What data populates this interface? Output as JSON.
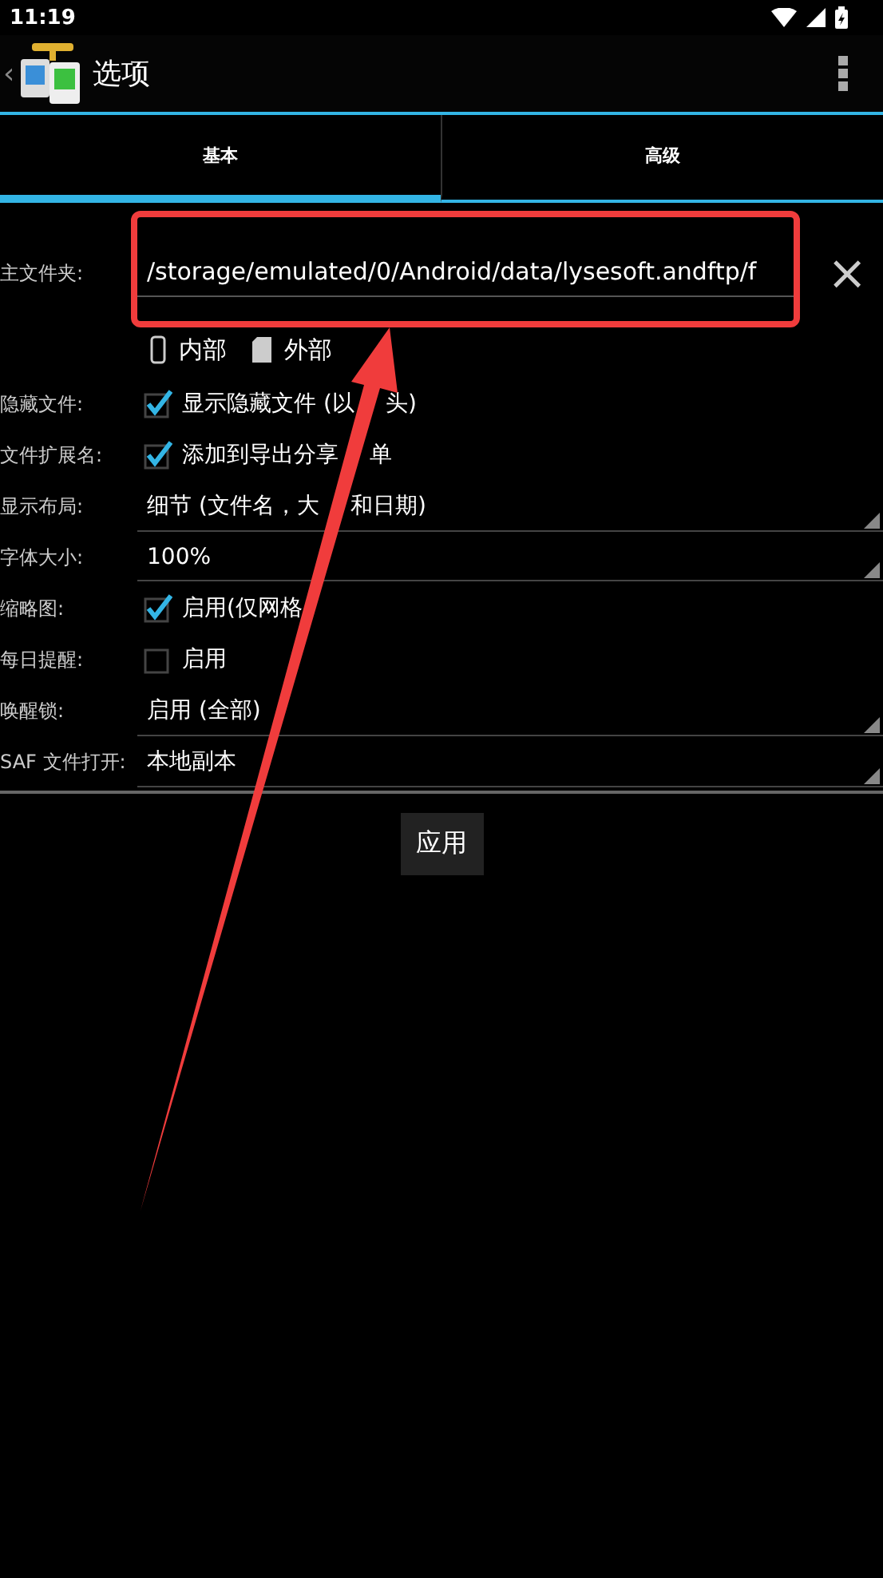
{
  "status_bar": {
    "time": "11:19"
  },
  "app_bar": {
    "back": "‹",
    "title": "选项"
  },
  "tabs": [
    {
      "label": "基本",
      "selected": true
    },
    {
      "label": "高级",
      "selected": false
    }
  ],
  "settings": [
    {
      "kind": "path",
      "label": "主文件夹:",
      "value": "/storage/emulated/0/Android/data/lysesoft.andftp/f",
      "clear": "×"
    },
    {
      "kind": "storage",
      "options": [
        "内部",
        "外部"
      ]
    },
    {
      "kind": "checkbox",
      "label": "隐藏文件:",
      "text_parts": [
        "显示隐藏文件 (以",
        "头)"
      ],
      "checked": true
    },
    {
      "kind": "checkbox",
      "label": "文件扩展名:",
      "text_parts": [
        "添加到导出分享",
        "单"
      ],
      "checked": true
    },
    {
      "kind": "dropdown",
      "label": "显示布局:",
      "text_parts": [
        "细节 (文件名，大",
        "和日期)"
      ]
    },
    {
      "kind": "dropdown",
      "label": "字体大小:",
      "text": "100%"
    },
    {
      "kind": "checkbox",
      "label": "缩略图:",
      "text": "启用(仅网格",
      "checked": true
    },
    {
      "kind": "checkbox",
      "label": "每日提醒:",
      "text": "启用",
      "checked": false
    },
    {
      "kind": "dropdown",
      "label": "唤醒锁:",
      "text": "启用 (全部)"
    },
    {
      "kind": "dropdown",
      "label": "SAF 文件打开:",
      "text": "本地副本"
    }
  ],
  "apply_button": "应用"
}
